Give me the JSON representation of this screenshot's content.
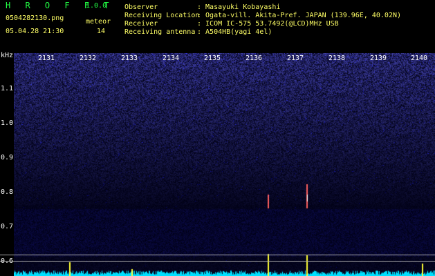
{
  "header": {
    "app_title": "H R O F F T",
    "version": "1.0.0",
    "file_name": "0504282130.png",
    "meteor_label": "meteor",
    "datetime": "05.04.28 21:30",
    "meteor_count": "14"
  },
  "info": [
    {
      "label": "Observer",
      "value": ": Masayuki Kobayashi"
    },
    {
      "label": "Receiving Location",
      "value": ": Ogata-vill. Akita-Pref. JAPAN (139.96E, 40.02N)"
    },
    {
      "label": "Receiver",
      "value": ": ICOM IC-575 53.7492(@LCD)MHz USB"
    },
    {
      "label": "Receiving antenna",
      "value": ": A504HB(yagi 4el)"
    }
  ],
  "axis": {
    "unit": "kHz",
    "y_ticks": [
      "1.1",
      "1.0",
      "0.9",
      "0.8",
      "0.7",
      "0.6"
    ],
    "x_ticks": [
      "2131",
      "2132",
      "2133",
      "2134",
      "2135",
      "2136",
      "2137",
      "2138",
      "2139",
      "2140"
    ]
  },
  "colors": {
    "background": "#000000",
    "spectrum_high": "#2a2aa8",
    "spectrum_low": "#10104a",
    "trace": "#00ffff",
    "peak": "#ffff33"
  }
}
